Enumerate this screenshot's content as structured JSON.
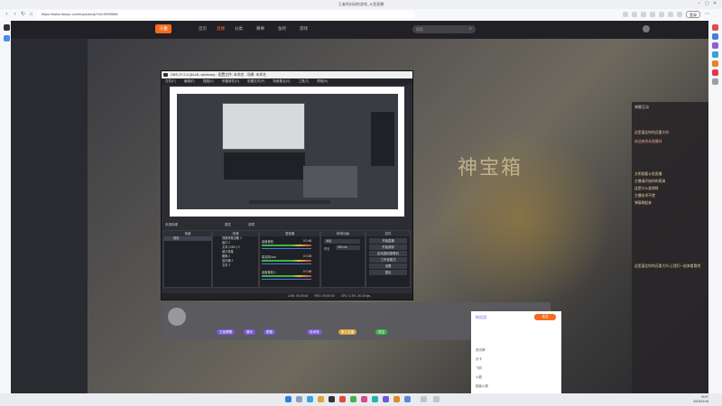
{
  "browser": {
    "title": "王者的封闭的游戏_斗鱼直播",
    "url": "https://www.douyu.com/topic/wzry?rid=9999566",
    "login_label": "登录"
  },
  "site": {
    "logo": "斗鱼",
    "nav": [
      "首页",
      "直播",
      "分类",
      "赛事",
      "鱼吧",
      "游戏"
    ],
    "search_placeholder": "搜索"
  },
  "hero": {
    "title": "神宝箱"
  },
  "obs": {
    "title": "OBS 27.2.4 (64-bit, windows) - 配置文件: 未命名 - 场景: 未命名",
    "menu": [
      "文件(F)",
      "编辑(E)",
      "视图(V)",
      "停靠部件(D)",
      "配置文件(P)",
      "场景集合(S)",
      "工具(T)",
      "帮助(H)"
    ],
    "scene_label": "未选择源",
    "props_label": "属性",
    "filters_label": "滤镜",
    "docks": {
      "scenes": "场景",
      "sources": "来源",
      "mixer": "混音器",
      "transitions": "转场动画",
      "controls": "控件"
    },
    "scenes": [
      "场景"
    ],
    "sources": [
      "视频采集设备 2",
      "窗口 2",
      "文本 (GDI+) 2",
      "窗口采集",
      "图像 2",
      "显示器 2",
      "文本 2"
    ],
    "mixer": [
      {
        "name": "桌面音频",
        "db": "0.0 dB"
      },
      {
        "name": "麦克风/Aux",
        "db": "0.0 dB"
      },
      {
        "name": "桌面音频 2",
        "db": "0.0 dB"
      }
    ],
    "transition": {
      "name": "淡出",
      "duration_label": "时长",
      "duration": "300 ms"
    },
    "controls": [
      "开始直播",
      "开始录制",
      "启动虚拟摄像机",
      "工作室模式",
      "设置",
      "退出"
    ],
    "status": {
      "live": "LIVE: 00:00:00",
      "rec": "REC: 00:00:00",
      "cpu": "CPU: 2.3%, 30.00 fps"
    }
  },
  "chat": {
    "header": "弹幕互动",
    "lines": [
      "这里面比你的还要大吗",
      "欢迎来到本直播间",
      "文明观看斗鱼直播",
      "主播请开始你的表演",
      "这是什么游戏呀",
      "主播技术不错",
      "弹幕刷起来",
      "这里面比你的还要大吗 让我们一起来看看吧"
    ]
  },
  "gifts": {
    "header": "粉丝团",
    "send_label": "发送",
    "items": [
      "荧光棒",
      "办卡",
      "飞机",
      "火箭",
      "超级火箭"
    ]
  },
  "room": {
    "tags": [
      "王者荣耀",
      "娱乐",
      "颜值",
      "技术流",
      "新人主播"
    ],
    "follow": "关注"
  },
  "taskbar": {
    "time": "15:57",
    "date": "2023/11/16"
  },
  "colors": {
    "accent": "#f76b1c",
    "obs_bg": "#2b2d33",
    "meter_green": "#3bb34a"
  }
}
